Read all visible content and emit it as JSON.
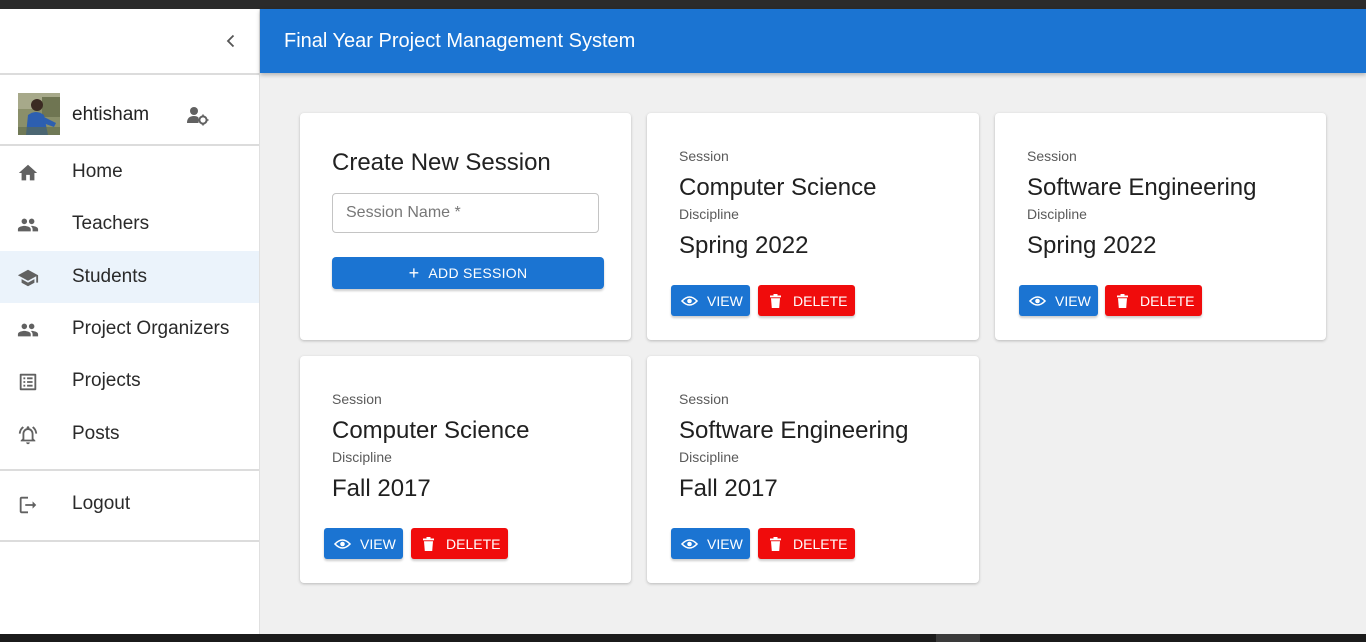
{
  "app": {
    "title": "Final Year Project Management System"
  },
  "user": {
    "name": "ehtisham"
  },
  "sidebar": {
    "items": [
      {
        "label": "Home",
        "icon": "home-icon"
      },
      {
        "label": "Teachers",
        "icon": "people-icon"
      },
      {
        "label": "Students",
        "icon": "school-icon",
        "active": true
      },
      {
        "label": "Project Organizers",
        "icon": "people-icon"
      },
      {
        "label": "Projects",
        "icon": "list-icon"
      },
      {
        "label": "Posts",
        "icon": "bell-icon"
      }
    ],
    "logout": "Logout"
  },
  "create": {
    "title": "Create New Session",
    "placeholder": "Session Name *",
    "button": "ADD SESSION"
  },
  "labels": {
    "session": "Session",
    "discipline": "Discipline",
    "view": "VIEW",
    "delete": "DELETE"
  },
  "sessions": [
    {
      "name": "Computer Science",
      "discipline": "Spring 2022"
    },
    {
      "name": "Software Engineering",
      "discipline": "Spring 2022"
    },
    {
      "name": "Computer Science",
      "discipline": "Fall 2017"
    },
    {
      "name": "Software Engineering",
      "discipline": "Fall 2017"
    }
  ],
  "colors": {
    "primary": "#1b74d2",
    "danger": "#f00c0c",
    "active_bg": "#ebf3fb"
  }
}
